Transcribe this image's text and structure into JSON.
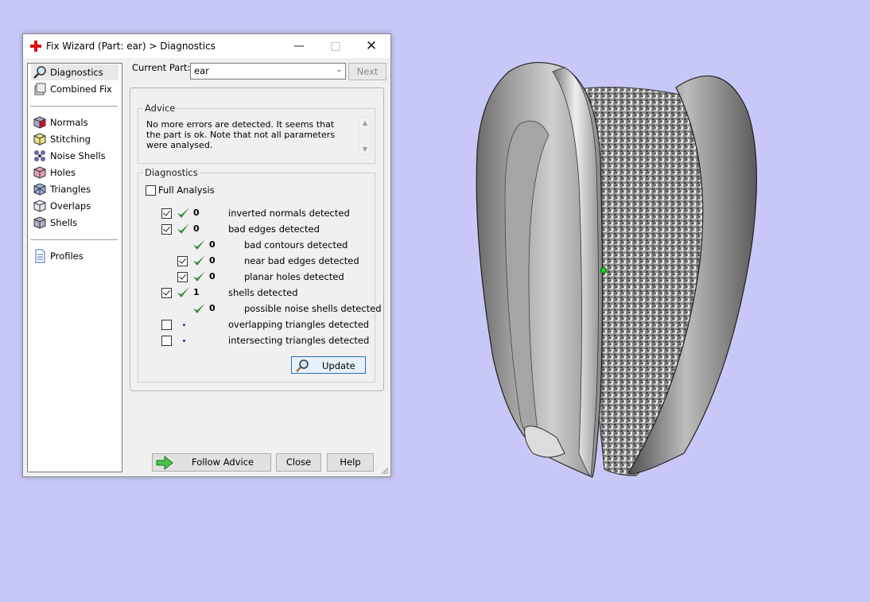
{
  "dialog": {
    "title": "Fix Wizard (Part: ear) > Diagnostics",
    "app_icon": "red-cross-icon",
    "window_buttons": [
      "minimize",
      "maximize",
      "close"
    ]
  },
  "sidebar": {
    "items": [
      {
        "label": "Diagnostics",
        "icon": "magnifier-icon",
        "selected": true
      },
      {
        "label": "Combined Fix",
        "icon": "stack-icon"
      },
      {
        "label": "Normals",
        "icon": "cube-red-icon"
      },
      {
        "label": "Stitching",
        "icon": "cube-yellow-icon"
      },
      {
        "label": "Noise Shells",
        "icon": "dots-icon"
      },
      {
        "label": "Holes",
        "icon": "cube-pink-icon"
      },
      {
        "label": "Triangles",
        "icon": "cube-blue-icon"
      },
      {
        "label": "Overlaps",
        "icon": "cube-outline-icon"
      },
      {
        "label": "Shells",
        "icon": "cube-grey-icon"
      },
      {
        "label": "Profiles",
        "icon": "document-icon"
      }
    ]
  },
  "part": {
    "label": "Current Part:",
    "value": "ear",
    "next_label": "Next"
  },
  "advice": {
    "legend": "Advice",
    "text": "No more errors are detected. It seems that the part is ok. Note that not all parameters were analysed."
  },
  "diagnostics": {
    "legend": "Diagnostics",
    "full_analysis_label": "Full Analysis",
    "full_analysis_checked": false,
    "rows": [
      {
        "checkbox": true,
        "checked": true,
        "status": "ok",
        "count": "0",
        "label": "inverted normals detected",
        "indent": 0
      },
      {
        "checkbox": true,
        "checked": true,
        "status": "ok",
        "count": "0",
        "label": "bad edges detected",
        "indent": 0
      },
      {
        "checkbox": false,
        "checked": false,
        "status": "ok",
        "count": "0",
        "label": "bad contours detected",
        "indent": 1
      },
      {
        "checkbox": true,
        "checked": true,
        "status": "ok",
        "count": "0",
        "label": "near bad edges detected",
        "indent": 1
      },
      {
        "checkbox": true,
        "checked": true,
        "status": "ok",
        "count": "0",
        "label": "planar holes detected",
        "indent": 1
      },
      {
        "checkbox": true,
        "checked": true,
        "status": "ok",
        "count": "1",
        "label": "shells detected",
        "indent": 0
      },
      {
        "checkbox": false,
        "checked": false,
        "status": "ok",
        "count": "0",
        "label": "possible noise shells detected",
        "indent": 1
      },
      {
        "checkbox": true,
        "checked": false,
        "status": "pending",
        "count": "",
        "label": "overlapping triangles detected",
        "indent": 0
      },
      {
        "checkbox": true,
        "checked": false,
        "status": "pending",
        "count": "",
        "label": "intersecting triangles detected",
        "indent": 0
      }
    ],
    "update_label": "Update"
  },
  "footer": {
    "follow_label": "Follow Advice",
    "close_label": "Close",
    "help_label": "Help"
  },
  "colors": {
    "background": "#c8c8f8",
    "ok_check": "#2e8b3e",
    "pending_dot": "#1a3bd4",
    "pivot_marker": "#22cc22"
  }
}
